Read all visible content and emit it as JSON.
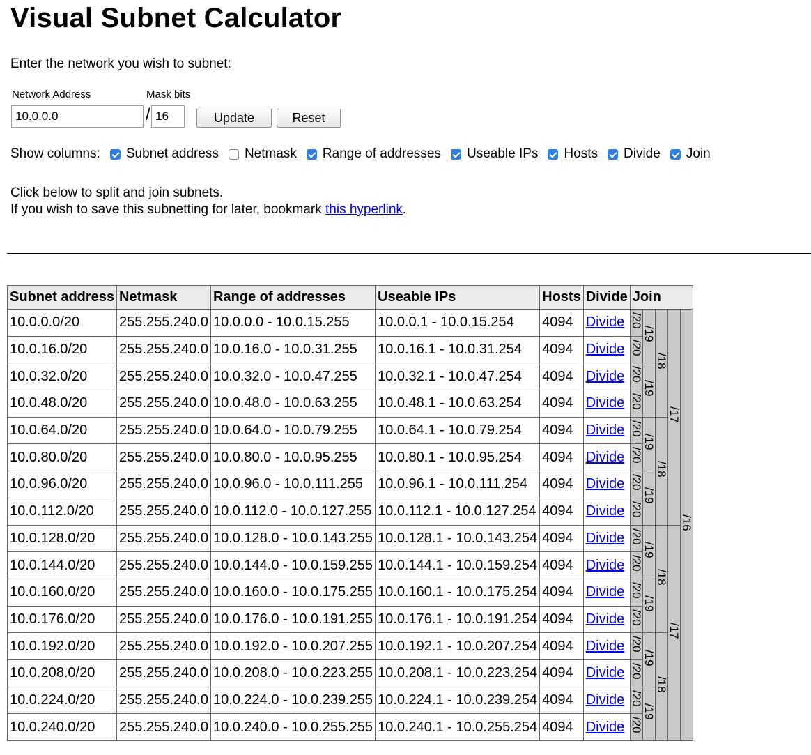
{
  "title": "Visual Subnet Calculator",
  "intro": "Enter the network you wish to subnet:",
  "form": {
    "network_label": "Network Address",
    "network_value": "10.0.0.0",
    "mask_label": "Mask bits",
    "slash": "/",
    "mask_value": "16",
    "update_label": "Update",
    "reset_label": "Reset"
  },
  "show_columns": {
    "label": "Show columns:",
    "options": [
      {
        "label": "Subnet address",
        "checked": true
      },
      {
        "label": "Netmask",
        "checked": false
      },
      {
        "label": "Range of addresses",
        "checked": true
      },
      {
        "label": "Useable IPs",
        "checked": true
      },
      {
        "label": "Hosts",
        "checked": true
      },
      {
        "label": "Divide",
        "checked": true
      },
      {
        "label": "Join",
        "checked": true
      }
    ]
  },
  "help": {
    "line1": "Click below to split and join subnets.",
    "line2_prefix": "If you wish to save this subnetting for later, bookmark ",
    "link_text": "this hyperlink",
    "line2_suffix": "."
  },
  "table": {
    "headers": [
      "Subnet address",
      "Netmask",
      "Range of addresses",
      "Useable IPs",
      "Hosts",
      "Divide",
      "Join"
    ],
    "rows": [
      [
        "10.0.0.0/20",
        "255.255.240.0",
        "10.0.0.0 - 10.0.15.255",
        "10.0.0.1 - 10.0.15.254",
        "4094",
        "Divide"
      ],
      [
        "10.0.16.0/20",
        "255.255.240.0",
        "10.0.16.0 - 10.0.31.255",
        "10.0.16.1 - 10.0.31.254",
        "4094",
        "Divide"
      ],
      [
        "10.0.32.0/20",
        "255.255.240.0",
        "10.0.32.0 - 10.0.47.255",
        "10.0.32.1 - 10.0.47.254",
        "4094",
        "Divide"
      ],
      [
        "10.0.48.0/20",
        "255.255.240.0",
        "10.0.48.0 - 10.0.63.255",
        "10.0.48.1 - 10.0.63.254",
        "4094",
        "Divide"
      ],
      [
        "10.0.64.0/20",
        "255.255.240.0",
        "10.0.64.0 - 10.0.79.255",
        "10.0.64.1 - 10.0.79.254",
        "4094",
        "Divide"
      ],
      [
        "10.0.80.0/20",
        "255.255.240.0",
        "10.0.80.0 - 10.0.95.255",
        "10.0.80.1 - 10.0.95.254",
        "4094",
        "Divide"
      ],
      [
        "10.0.96.0/20",
        "255.255.240.0",
        "10.0.96.0 - 10.0.111.255",
        "10.0.96.1 - 10.0.111.254",
        "4094",
        "Divide"
      ],
      [
        "10.0.112.0/20",
        "255.255.240.0",
        "10.0.112.0 - 10.0.127.255",
        "10.0.112.1 - 10.0.127.254",
        "4094",
        "Divide"
      ],
      [
        "10.0.128.0/20",
        "255.255.240.0",
        "10.0.128.0 - 10.0.143.255",
        "10.0.128.1 - 10.0.143.254",
        "4094",
        "Divide"
      ],
      [
        "10.0.144.0/20",
        "255.255.240.0",
        "10.0.144.0 - 10.0.159.255",
        "10.0.144.1 - 10.0.159.254",
        "4094",
        "Divide"
      ],
      [
        "10.0.160.0/20",
        "255.255.240.0",
        "10.0.160.0 - 10.0.175.255",
        "10.0.160.1 - 10.0.175.254",
        "4094",
        "Divide"
      ],
      [
        "10.0.176.0/20",
        "255.255.240.0",
        "10.0.176.0 - 10.0.191.255",
        "10.0.176.1 - 10.0.191.254",
        "4094",
        "Divide"
      ],
      [
        "10.0.192.0/20",
        "255.255.240.0",
        "10.0.192.0 - 10.0.207.255",
        "10.0.192.1 - 10.0.207.254",
        "4094",
        "Divide"
      ],
      [
        "10.0.208.0/20",
        "255.255.240.0",
        "10.0.208.0 - 10.0.223.255",
        "10.0.208.1 - 10.0.223.254",
        "4094",
        "Divide"
      ],
      [
        "10.0.224.0/20",
        "255.255.240.0",
        "10.0.224.0 - 10.0.239.255",
        "10.0.224.1 - 10.0.239.254",
        "4094",
        "Divide"
      ],
      [
        "10.0.240.0/20",
        "255.255.240.0",
        "10.0.240.0 - 10.0.255.255",
        "10.0.240.1 - 10.0.255.254",
        "4094",
        "Divide"
      ]
    ],
    "join_levels": [
      {
        "label": "/20",
        "span": 1
      },
      {
        "label": "/19",
        "span": 2
      },
      {
        "label": "/18",
        "span": 4
      },
      {
        "label": "/17",
        "span": 8
      },
      {
        "label": "/16",
        "span": 16
      }
    ]
  }
}
